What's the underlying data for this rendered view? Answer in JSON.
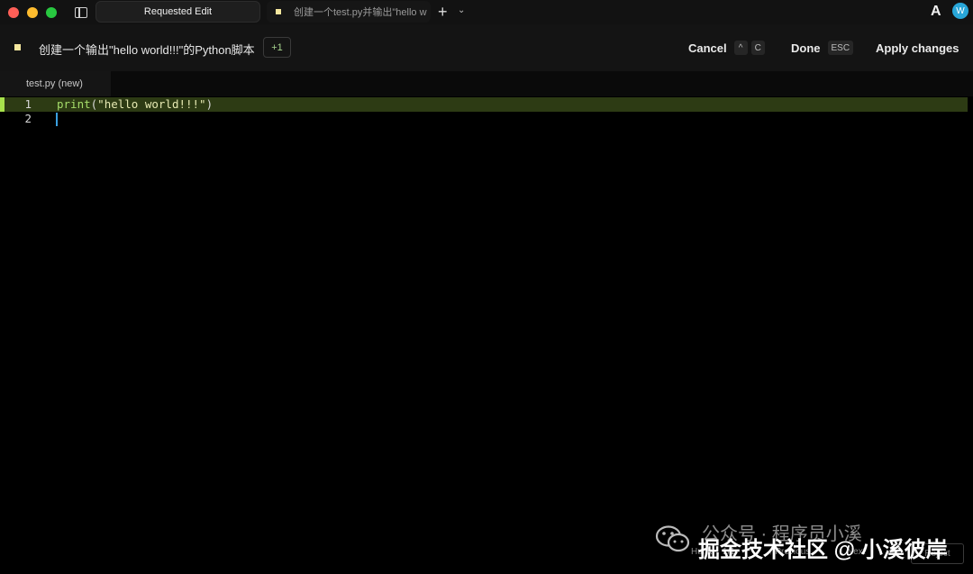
{
  "window": {
    "traffic_colors": [
      "#ff5f57",
      "#febc2e",
      "#28c840"
    ]
  },
  "tabs": [
    {
      "label": "Requested Edit",
      "active": true
    },
    {
      "label": "创建一个test.py并输出\"hello w",
      "active": false
    }
  ],
  "header": {
    "title": "创建一个输出\"hello world!!!\"的Python脚本",
    "badge": "+1",
    "cancel_label": "Cancel",
    "cancel_key_1": "^",
    "cancel_key_2": "C",
    "done_label": "Done",
    "done_key": "ESC",
    "apply_label": "Apply changes"
  },
  "file_tab": {
    "label": "test.py (new)"
  },
  "editor": {
    "lines": [
      {
        "num": "1",
        "fn": "print",
        "open": "(",
        "str": "\"hello world!!!\"",
        "close": ")"
      },
      {
        "num": "2"
      }
    ]
  },
  "watermark": {
    "line1": "公众号 · 程序员小溪",
    "line2": "掘金技术社区 @ 小溪彼岸"
  },
  "hunk": {
    "label": "Hunk:",
    "count": "1/1",
    "previous": "↑ Previous",
    "next": "↓ Next",
    "reject": "Reject"
  },
  "avatar": {
    "letter": "W"
  },
  "logo": {
    "letter": "A"
  },
  "colors": {
    "accent_yellow": "#f5e79e",
    "added_line": "#2d3b14",
    "added_marker": "#a7e24c",
    "caret": "#3aa0e0"
  }
}
